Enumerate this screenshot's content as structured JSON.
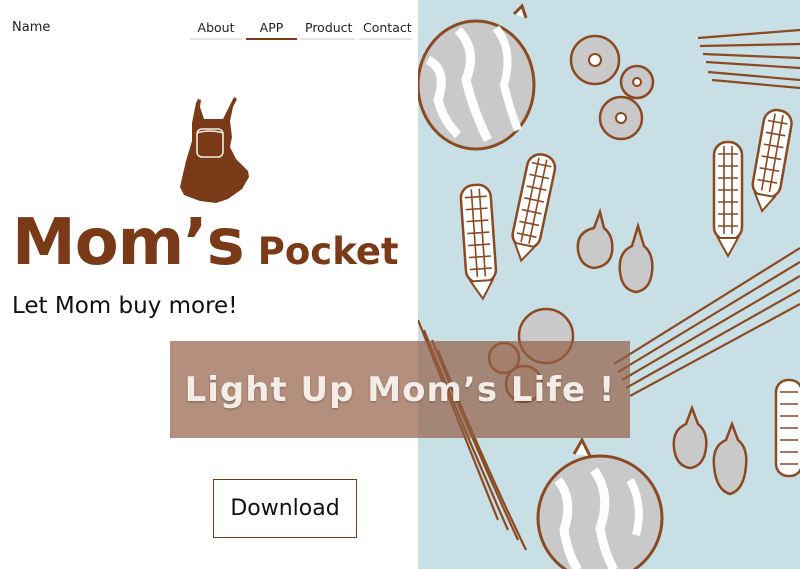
{
  "header": {
    "brand": "Name",
    "nav": [
      {
        "label": "About",
        "active": false
      },
      {
        "label": "APP",
        "active": true
      },
      {
        "label": "Product",
        "active": false
      },
      {
        "label": "Contact",
        "active": false
      }
    ]
  },
  "hero": {
    "logo_icon": "apron-icon",
    "title_big": "Mom’s",
    "title_small": "Pocket",
    "tagline": "Let Mom buy more!",
    "banner": "Light Up Mom’s Life !",
    "download_label": "Download"
  },
  "colors": {
    "brand_brown": "#7a3a17",
    "panel_blue": "#c9dfe6",
    "banner_overlay": "#946046"
  },
  "illustration": {
    "items": [
      "watermelon-icon",
      "corn-icon",
      "tomato-icon",
      "garlic-icon",
      "scallion-icon"
    ]
  }
}
